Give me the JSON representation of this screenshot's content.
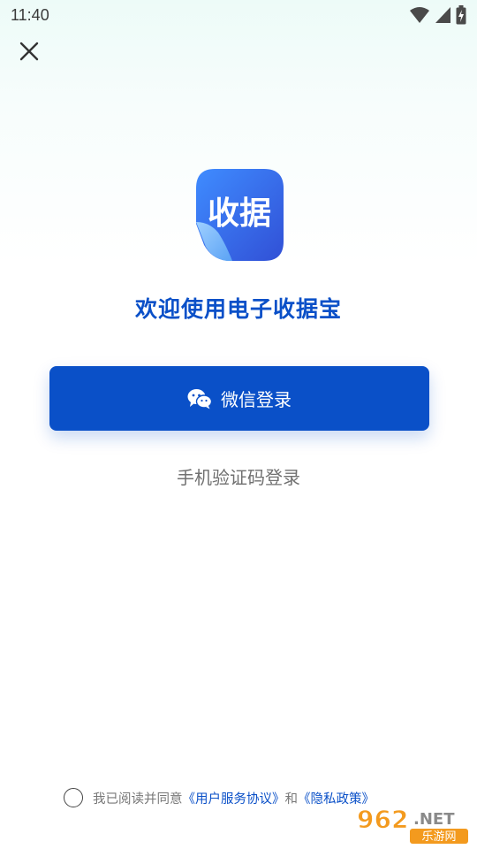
{
  "status_bar": {
    "time": "11:40",
    "icons": [
      "wifi-icon",
      "signal-icon",
      "battery-icon"
    ]
  },
  "close_icon": "close-icon",
  "logo": {
    "text": "收据",
    "icon": "app-logo-icon"
  },
  "welcome_text": "欢迎使用电子收据宝",
  "wechat_button": {
    "label": "微信登录",
    "icon": "wechat-icon"
  },
  "sms_login_label": "手机验证码登录",
  "agreement": {
    "prefix": "我已阅读并同意",
    "user_agreement": "《用户服务协议》",
    "and": "和",
    "privacy_policy": "《隐私政策》",
    "checked": false
  },
  "watermark": {
    "number": "962",
    "suffix": ".NET",
    "subtitle": "乐游网"
  },
  "colors": {
    "accent": "#0a50c8",
    "logo_gradient_start": "#3f8cff",
    "logo_gradient_end": "#3150d6"
  }
}
